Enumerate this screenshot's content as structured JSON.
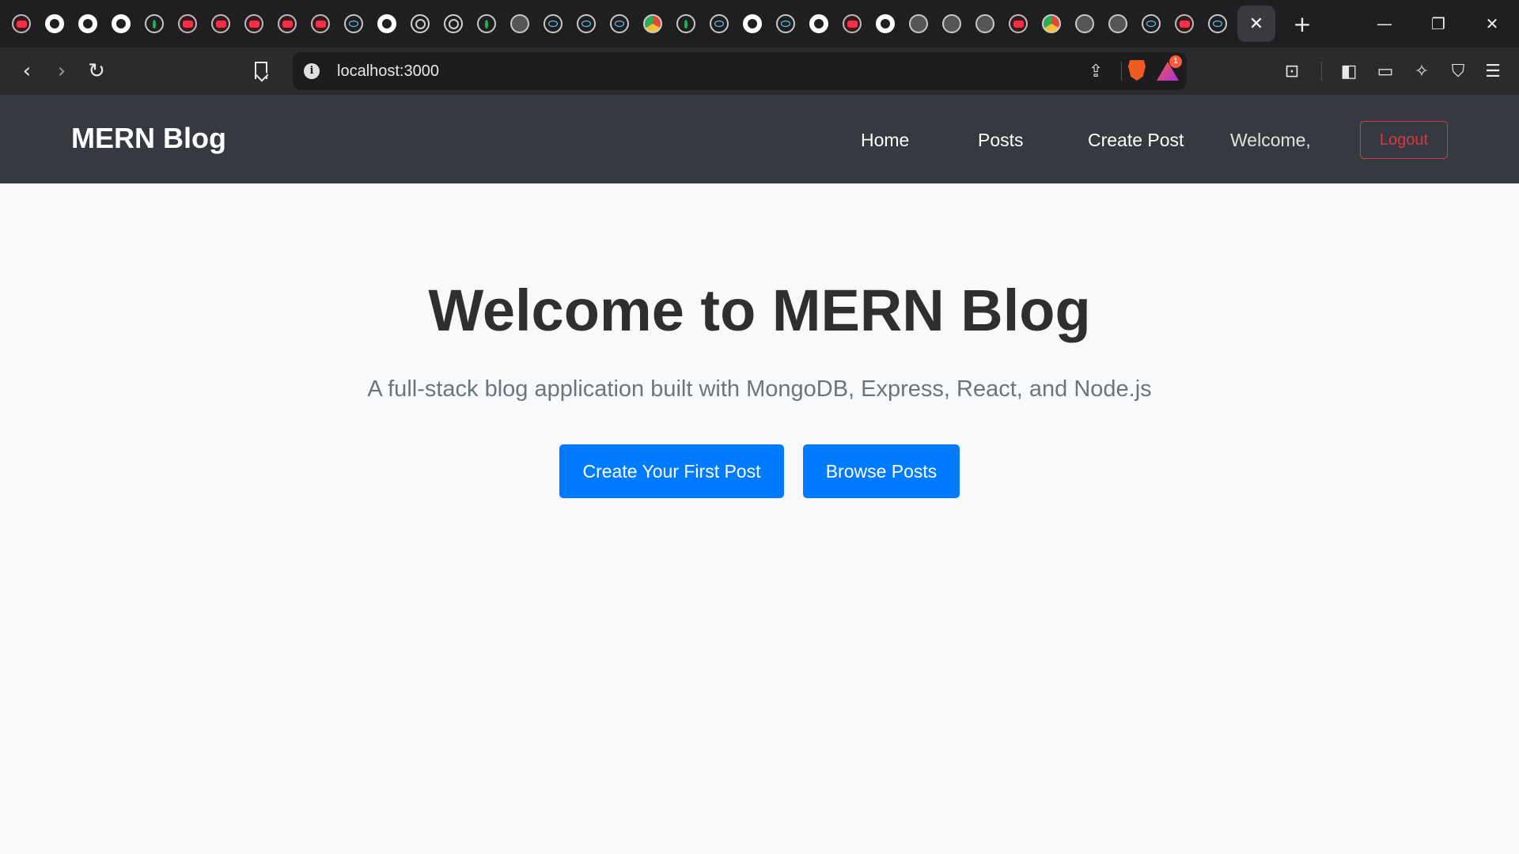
{
  "browser": {
    "tab_favicons": [
      "brave-icon",
      "github-icon",
      "github-icon",
      "github-icon",
      "mongodb-icon",
      "youtube-icon",
      "youtube-icon",
      "youtube-icon",
      "youtube-icon",
      "gmail-icon",
      "react-icon",
      "github-icon",
      "openai-icon",
      "openai-icon",
      "mongodb-icon",
      "globe-icon",
      "react-icon",
      "react-icon",
      "react-icon",
      "chrome-icon",
      "mongodb-icon",
      "react-icon",
      "github-icon",
      "edge-icon",
      "github-icon",
      "brave-icon",
      "github-icon",
      "globe-icon",
      "globe-icon",
      "globe-icon",
      "app-icon",
      "drive-icon",
      "globe-icon",
      "globe-icon",
      "tailwind-icon",
      "brave-icon",
      "vite-icon"
    ],
    "active_tab_close": "✕",
    "new_tab": "+",
    "address": "localhost:3000",
    "rewards_badge": "1"
  },
  "navbar": {
    "brand": "MERN Blog",
    "links": [
      "Home",
      "Posts",
      "Create Post"
    ],
    "welcome": "Welcome,",
    "logout": "Logout"
  },
  "hero": {
    "title": "Welcome to MERN Blog",
    "subtitle": "A full-stack blog application built with MongoDB, Express, React, and Node.js",
    "primary_button": "Create Your First Post",
    "secondary_button": "Browse Posts"
  },
  "colors": {
    "navbar_bg": "#343a40",
    "primary": "#007bff",
    "danger": "#dc3545",
    "page_bg": "#f8f9fa"
  }
}
